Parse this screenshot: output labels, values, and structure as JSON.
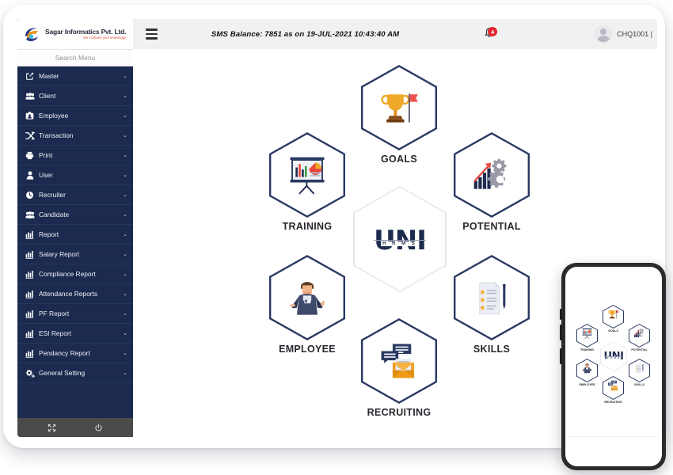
{
  "brand": {
    "name": "Sagar Informatics Pvt. Ltd.",
    "tagline": "We Cultivate your knowledge",
    "logo_icon": "sagar-swoosh-logo"
  },
  "sidebar": {
    "search_placeholder": "Search Menu",
    "items": [
      {
        "label": "Master",
        "icon": "external-link-icon",
        "chevron": "⌄"
      },
      {
        "label": "Client",
        "icon": "users-group-icon",
        "chevron": "⌄"
      },
      {
        "label": "Employee",
        "icon": "id-badge-icon",
        "chevron": "⌄"
      },
      {
        "label": "Transaction",
        "icon": "shuffle-icon",
        "chevron": "⌄"
      },
      {
        "label": "Print",
        "icon": "printer-icon",
        "chevron": "⌄"
      },
      {
        "label": "User",
        "icon": "user-icon",
        "chevron": "⌄"
      },
      {
        "label": "Recruiter",
        "icon": "clock-user-icon",
        "chevron": "⌄"
      },
      {
        "label": "Candidate",
        "icon": "users-group-icon",
        "chevron": "⌄"
      },
      {
        "label": "Report",
        "icon": "bar-chart-icon",
        "chevron": "⌄"
      },
      {
        "label": "Salary Report",
        "icon": "bar-chart-icon",
        "chevron": "⌄"
      },
      {
        "label": "Compliance Report",
        "icon": "bar-chart-icon",
        "chevron": "⌄"
      },
      {
        "label": "Attendance Reports",
        "icon": "bar-chart-icon",
        "chevron": "⌄"
      },
      {
        "label": "PF Report",
        "icon": "bar-chart-icon",
        "chevron": "⌄"
      },
      {
        "label": "ESI Report",
        "icon": "bar-chart-icon",
        "chevron": "⌄"
      },
      {
        "label": "Pendancy Report",
        "icon": "bar-chart-icon",
        "chevron": "⌄"
      },
      {
        "label": "General Setting",
        "icon": "gears-icon",
        "chevron": "⌄"
      }
    ],
    "footer": {
      "expand_icon": "expand-arrows-icon",
      "power_icon": "power-icon"
    }
  },
  "topbar": {
    "menu_toggle_icon": "hamburger-icon",
    "sms_balance": "SMS Balance: 7851 as on 19-JUL-2021 10:43:40 AM",
    "notification_icon": "bell-icon",
    "notification_count": "4",
    "avatar_icon": "user-avatar-icon",
    "user_label": "CHQ1001 |"
  },
  "dashboard": {
    "center": {
      "logo_text": "UNI",
      "logo_sub": "H R M S"
    },
    "modules": [
      {
        "label": "GOALS",
        "icon": "trophy-flag-icon"
      },
      {
        "label": "POTENTIAL",
        "icon": "growth-gears-icon"
      },
      {
        "label": "SKILLS",
        "icon": "document-pen-icon"
      },
      {
        "label": "RECRUITING",
        "icon": "chat-envelope-icon"
      },
      {
        "label": "EMPLOYEE",
        "icon": "employee-person-icon"
      },
      {
        "label": "TRAINING",
        "icon": "presentation-chart-icon"
      }
    ]
  },
  "phone": {
    "center": {
      "logo_text": "UNI",
      "logo_sub": "H R M S"
    },
    "modules": [
      {
        "label": "GOALS",
        "icon": "trophy-flag-icon"
      },
      {
        "label": "POTENTIAL",
        "icon": "growth-gears-icon"
      },
      {
        "label": "SKILLS",
        "icon": "document-pen-icon"
      },
      {
        "label": "RECRUITING",
        "icon": "chat-envelope-icon"
      },
      {
        "label": "EMPLOYEE",
        "icon": "employee-person-icon"
      },
      {
        "label": "TRAINING",
        "icon": "presentation-chart-icon"
      }
    ]
  },
  "colors": {
    "sidebar_bg": "#1b2a4e",
    "hex_border": "#2a3a63",
    "accent_orange": "#f0a024",
    "accent_red": "#e3232f",
    "topbar_bg": "#f1f1f1"
  }
}
